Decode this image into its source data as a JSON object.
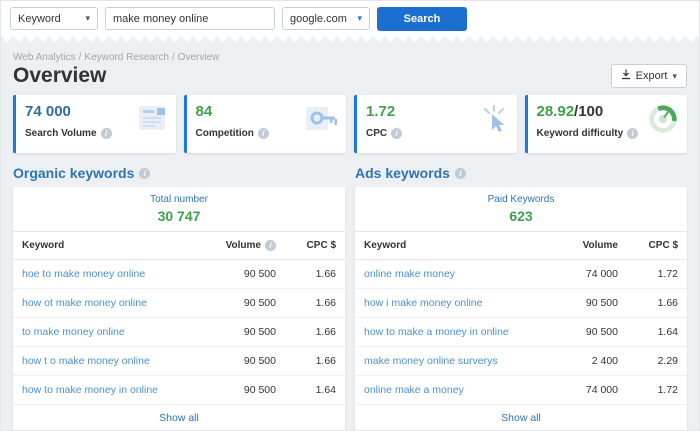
{
  "topbar": {
    "keyword_type_select": "Keyword",
    "query_value": "make money online",
    "engine_select": "google.com",
    "search_button": "Search"
  },
  "icons": {
    "chevron_down": "▾",
    "info": "i"
  },
  "breadcrumb": {
    "items": [
      "Web Analytics",
      "Keyword Research",
      "Overview"
    ],
    "separator": "/"
  },
  "page": {
    "title": "Overview",
    "export_button": "Export"
  },
  "metrics": [
    {
      "value": "74 000",
      "label": "Search Volume"
    },
    {
      "value": "84",
      "label": "Competition"
    },
    {
      "value": "1.72",
      "label": "CPC"
    },
    {
      "value": "28.92",
      "suffix": "/100",
      "label": "Keyword difficulty"
    }
  ],
  "organic": {
    "section_title": "Organic keywords",
    "total_label": "Total number",
    "total_value": "30 747",
    "columns": {
      "keyword": "Keyword",
      "volume": "Volume",
      "cpc": "CPC $"
    },
    "rows": [
      {
        "keyword": "hoe to make money online",
        "volume": "90 500",
        "cpc": "1.66"
      },
      {
        "keyword": "how ot make money online",
        "volume": "90 500",
        "cpc": "1.66"
      },
      {
        "keyword": "to make money online",
        "volume": "90 500",
        "cpc": "1.66"
      },
      {
        "keyword": "how t o make money online",
        "volume": "90 500",
        "cpc": "1.66"
      },
      {
        "keyword": "how to make money in online",
        "volume": "90 500",
        "cpc": "1.64"
      }
    ],
    "show_all": "Show all"
  },
  "ads": {
    "section_title": "Ads keywords",
    "total_label": "Paid Keywords",
    "total_value": "623",
    "columns": {
      "keyword": "Keyword",
      "volume": "Volume",
      "cpc": "CPC $"
    },
    "rows": [
      {
        "keyword": "online make money",
        "volume": "74 000",
        "cpc": "1.72"
      },
      {
        "keyword": "how i make money online",
        "volume": "90 500",
        "cpc": "1.66"
      },
      {
        "keyword": "how to make a money in online",
        "volume": "90 500",
        "cpc": "1.64"
      },
      {
        "keyword": "make money online surverys",
        "volume": "2 400",
        "cpc": "2.29"
      },
      {
        "keyword": "online make a money",
        "volume": "74 000",
        "cpc": "1.72"
      }
    ],
    "show_all": "Show all"
  },
  "colors": {
    "accent_blue": "#1e78d7",
    "button_blue": "#1a6fd0",
    "value_blue": "#2d6ca2",
    "value_green": "#3fa14c",
    "link_blue": "#4a90d2",
    "section_blue": "#2e74b5",
    "page_background": "#edf0f3"
  }
}
